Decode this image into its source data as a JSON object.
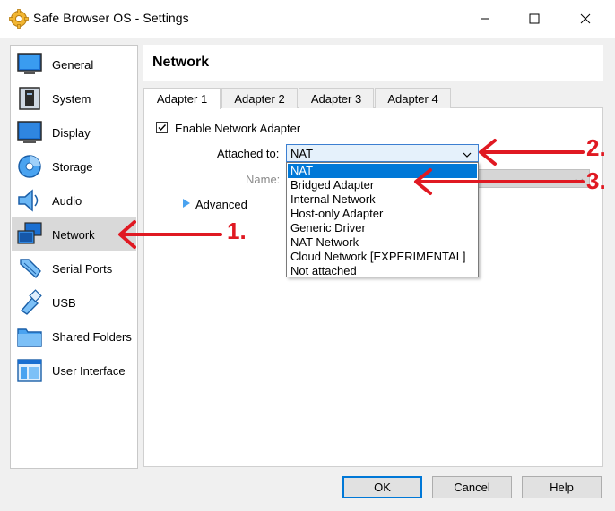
{
  "window": {
    "title": "Safe Browser OS - Settings"
  },
  "sidebar": {
    "items": [
      {
        "label": "General",
        "icon": "general-icon"
      },
      {
        "label": "System",
        "icon": "system-icon"
      },
      {
        "label": "Display",
        "icon": "display-icon"
      },
      {
        "label": "Storage",
        "icon": "storage-icon"
      },
      {
        "label": "Audio",
        "icon": "audio-icon"
      },
      {
        "label": "Network",
        "icon": "network-icon",
        "selected": true
      },
      {
        "label": "Serial Ports",
        "icon": "serial-ports-icon"
      },
      {
        "label": "USB",
        "icon": "usb-icon"
      },
      {
        "label": "Shared Folders",
        "icon": "shared-folders-icon"
      },
      {
        "label": "User Interface",
        "icon": "user-interface-icon"
      }
    ]
  },
  "page": {
    "title": "Network",
    "tabs": [
      {
        "label": "Adapter 1",
        "active": true
      },
      {
        "label": "Adapter 2"
      },
      {
        "label": "Adapter 3"
      },
      {
        "label": "Adapter 4"
      }
    ],
    "enable_adapter": {
      "label": "Enable Network Adapter",
      "checked": true
    },
    "attached_to": {
      "label": "Attached to:",
      "value": "NAT",
      "options": [
        "NAT",
        "Bridged Adapter",
        "Internal Network",
        "Host-only Adapter",
        "Generic Driver",
        "NAT Network",
        "Cloud Network [EXPERIMENTAL]",
        "Not attached"
      ],
      "highlighted": "NAT"
    },
    "name_label": "Name:",
    "advanced_label": "Advanced"
  },
  "buttons": {
    "ok": "OK",
    "cancel": "Cancel",
    "help": "Help"
  },
  "annotations": {
    "step1": "1.",
    "step2": "2.",
    "step3": "3.",
    "color": "#e01922"
  },
  "colors": {
    "selection": "#0078d7",
    "sidebar_selected": "#d9d9d9",
    "accent": "#3c7fd1"
  }
}
